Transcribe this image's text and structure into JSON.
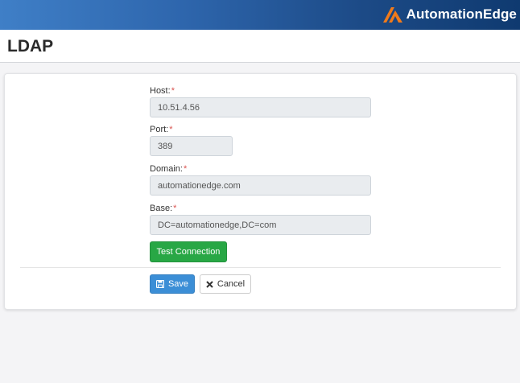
{
  "brand": {
    "name": "AutomationEdge"
  },
  "page": {
    "title": "LDAP"
  },
  "form": {
    "host": {
      "label": "Host:",
      "required_mark": "*",
      "value": "10.51.4.56"
    },
    "port": {
      "label": "Port:",
      "required_mark": "*",
      "value": "389"
    },
    "domain": {
      "label": "Domain:",
      "required_mark": "*",
      "value": "automationedge.com"
    },
    "base": {
      "label": "Base:",
      "required_mark": "*",
      "value": "DC=automationedge,DC=com"
    }
  },
  "actions": {
    "test_connection_label": "Test Connection",
    "save_label": "Save",
    "cancel_label": "Cancel"
  },
  "icons": {
    "logo": "automationedge-logo-icon",
    "save": "floppy-disk-icon",
    "cancel": "close-x-icon"
  },
  "colors": {
    "header_gradient_start": "#3f7fc7",
    "header_gradient_end": "#0f3a70",
    "logo_accent": "#f07a1a",
    "test_button": "#28a745",
    "save_button": "#3b8ed6",
    "required": "#d9534f"
  }
}
